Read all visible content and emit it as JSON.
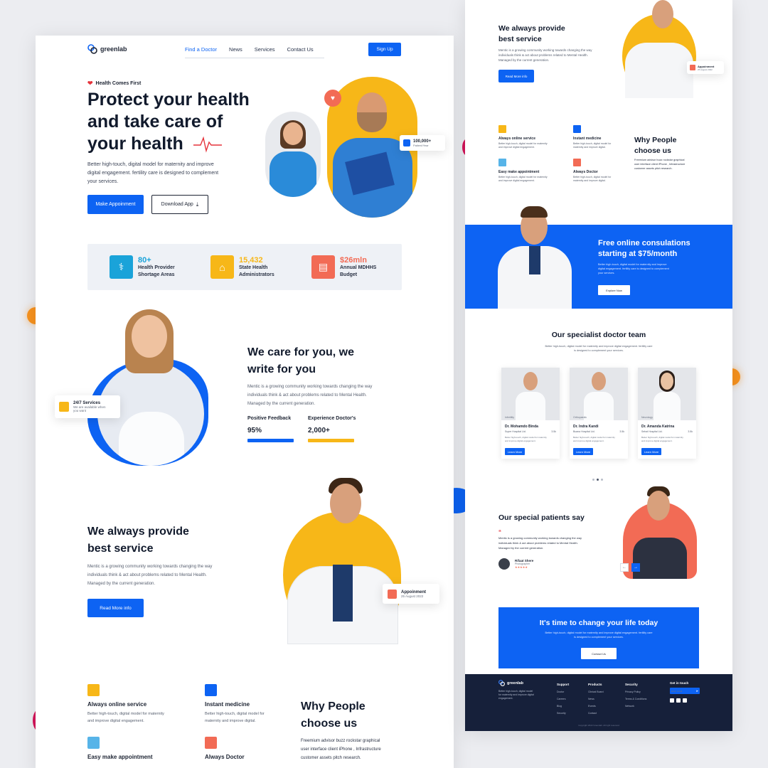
{
  "nav": {
    "brand": "greenlab",
    "links": [
      "Find a Doctor",
      "News",
      "Services",
      "Contact Us"
    ],
    "signup": "Sign Up"
  },
  "hero": {
    "badge": "Health Comes First",
    "title_l1": "Protect your health",
    "title_l2": "and take care of",
    "title_l3": "your health",
    "desc_l1": "Better high-touch, digital model for maternity and improve",
    "desc_l2": "digital engagement. fertility care is designed to complement",
    "desc_l3": "your services.",
    "btn_appointment": "Make Appoinment",
    "btn_download": "Download App",
    "patients_count": "100,000+",
    "patients_label": "Patient/Year"
  },
  "stats": [
    {
      "value": "80+",
      "label_l1": "Health Provider",
      "label_l2": "Shortage Areas",
      "color": "#1aa3d9"
    },
    {
      "value": "15,432",
      "label_l1": "State Health",
      "label_l2": "Administrators",
      "color": "#f7b718"
    },
    {
      "value": "$26mln",
      "label_l1": "Annual MDHHS",
      "label_l2": "Budget",
      "color": "#f26b55"
    }
  ],
  "care": {
    "title_l1": "We care for you, we",
    "title_l2": "write for you",
    "desc_l1": "Mentic is a growing community working towards changing the way",
    "desc_l2": "individuals think & act about problems related to Mental Health.",
    "desc_l3": "Managed by the current generation.",
    "service_title": "24/7 Services",
    "service_sub_l1": "We are available when",
    "service_sub_l2": "you want",
    "metric1_label": "Positive Feedback",
    "metric1_value": "95%",
    "metric2_label": "Experience Doctor's",
    "metric2_value": "2,000+"
  },
  "service": {
    "title_l1": "We always provide",
    "title_l2": "best service",
    "desc_l1": "Mentic is a growing community working towards changing the way",
    "desc_l2": "individuals think & act about problems related to Mental Health.",
    "desc_l3": "Managed by the current generation.",
    "btn": "Read More info",
    "appt_title": "Appoinment",
    "appt_date": "25 August 2022"
  },
  "features": {
    "items": [
      {
        "title": "Always online service",
        "desc_l1": "Better high-touch, digital model for maternity",
        "desc_l2": "and improve digital engagement."
      },
      {
        "title": "Instant medicine",
        "desc_l1": "Better high-touch, digital model for",
        "desc_l2": "maternity and improve digital."
      },
      {
        "title": "Easy make appointment",
        "desc_l1": "Better high-touch, digital model for maternity",
        "desc_l2": "and improve digital engagement."
      },
      {
        "title": "Always Doctor",
        "desc_l1": "Better high-touch, digital model for",
        "desc_l2": "maternity and improve digital."
      }
    ],
    "why_l1": "Why People",
    "why_l2": "choose us",
    "why_desc_l1": "Freemium advisor buzz rockstar graphical",
    "why_desc_l2": "user interface client iPhone , Infrastructure",
    "why_desc_l3": "customer assets pitch research."
  },
  "right": {
    "service_title_l1": "We always provide",
    "service_title_l2": "best service",
    "service_desc_l1": "Mentic is a growing community working towards changing the way",
    "service_desc_l2": "individuals think & act about problems related to Mental Health.",
    "service_desc_l3": "Managed by the current generation.",
    "service_btn": "Read More info",
    "appt_title": "Appoinment",
    "appt_date": "25 August 2022",
    "features": [
      {
        "title": "Always online service",
        "desc_l1": "Better high-touch, digital model for maternity",
        "desc_l2": "and improve digital engagement."
      },
      {
        "title": "Instant medicine",
        "desc_l1": "Better high-touch, digital model for",
        "desc_l2": "maternity and improve digital."
      },
      {
        "title": "Easy make appointment",
        "desc_l1": "Better high-touch, digital model for maternity",
        "desc_l2": "and improve digital engagement."
      },
      {
        "title": "Always Doctor",
        "desc_l1": "Better high-touch, digital model for",
        "desc_l2": "maternity and improve digital."
      }
    ],
    "why_l1": "Why People",
    "why_l2": "choose us",
    "why_desc_l1": "Freemium advisor buzz rockstar graphical",
    "why_desc_l2": "user interface client iPhone , Infrastructure",
    "why_desc_l3": "customer assets pitch research.",
    "consult_l1": "Free online consulations",
    "consult_l2": "starting at $75/month",
    "consult_desc_l1": "Better high-touch, digital model for maternity and improve",
    "consult_desc_l2": "digital engagement. fertility care is designed to complement",
    "consult_desc_l3": "your services.",
    "consult_btn": "Explore Now",
    "team_title": "Our specialist doctor team",
    "team_desc_l1": "Better high-touch, digital model for maternity and improve digital engagement. fertility care",
    "team_desc_l2": "is designed to complement your services.",
    "doctors": [
      {
        "spec": "Infertility",
        "name": "Dr. Mohamdo Binda",
        "hosp": "Super Hospital Ltd.",
        "rating": "3.5k",
        "desc_l1": "Better high-touch, digital model for maternity",
        "desc_l2": "and improve digital engagement.",
        "btn": "Learn More"
      },
      {
        "spec": "Orthopaedic",
        "name": "Dr. Indra Kandi",
        "hosp": "Buana Hospital Ltd.",
        "rating": "3.5k",
        "desc_l1": "Better high-touch, digital model for maternity",
        "desc_l2": "and improve digital engagement.",
        "btn": "Learn More"
      },
      {
        "spec": "Neurology",
        "name": "Dr. Amanda Katrina",
        "hosp": "Sehat Hospital Ltd.",
        "rating": "3.5k",
        "desc_l1": "Better high-touch, digital model for maternity",
        "desc_l2": "and improve digital engagement.",
        "btn": "Learn More"
      }
    ],
    "patients_title": "Our special patients say",
    "patients_quote_l1": "Mentic is a growing community working towards changing the way",
    "patients_quote_l2": "individuals think & act about problems related to Mental Health.",
    "patients_quote_l3": "Managed by the current generation.",
    "patient_name": "Rifaat Shere",
    "patient_role": "Photographer",
    "patient_stars": "★★★★★",
    "cta_title": "It's time to change your life today",
    "cta_desc_l1": "Better high-touch, digital model for maternity and improve digital engagement. fertility care",
    "cta_desc_l2": "is designed to complement your services.",
    "cta_btn": "Contact Us",
    "footer_brand": "greenlab",
    "footer_desc_l1": "Better high-touch, digital model",
    "footer_desc_l2": "for maternity and improve digital",
    "footer_desc_l3": "engagement.",
    "footer_cols": [
      {
        "title": "Support",
        "links": [
          "Doctor",
          "Careers",
          "Blog",
          "Security"
        ]
      },
      {
        "title": "Products",
        "links": [
          "Clinical Board",
          "News",
          "Events",
          "Contact"
        ]
      },
      {
        "title": "Security",
        "links": [
          "Privacy Policy",
          "Terms & Conditions",
          "Network"
        ]
      }
    ],
    "footer_touch": "Get in touch",
    "footer_email_placeholder": "Enter email",
    "copyright": "Copyright 2022 Greenlab. All right reserved"
  },
  "colors": {
    "accent": "#0d63f3",
    "yellow": "#f7b718",
    "orange": "#f26b55",
    "navy": "#16203a"
  }
}
